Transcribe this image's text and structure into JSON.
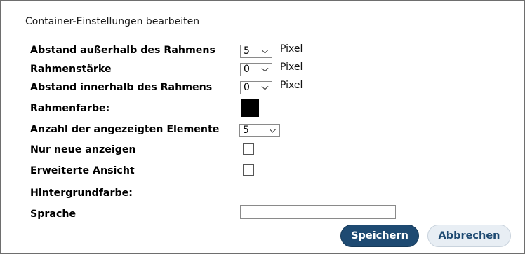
{
  "dialog": {
    "title": "Container-Einstellungen bearbeiten"
  },
  "fields": {
    "margin_outside": {
      "label": "Abstand außerhalb des Rahmens",
      "value": "5",
      "unit": "Pixel"
    },
    "border_width": {
      "label": "Rahmenstärke",
      "value": "0",
      "unit": "Pixel"
    },
    "padding_inside": {
      "label": "Abstand innerhalb des Rahmens",
      "value": "0",
      "unit": "Pixel"
    },
    "border_color": {
      "label": "Rahmenfarbe:",
      "value": "#000000"
    },
    "item_count": {
      "label": "Anzahl der angezeigten Elemente",
      "value": "5"
    },
    "only_new": {
      "label": "Nur neue anzeigen",
      "checked": false
    },
    "extended_view": {
      "label": "Erweiterte Ansicht",
      "checked": false
    },
    "background_color": {
      "label": "Hintergrundfarbe:"
    },
    "language": {
      "label": "Sprache",
      "value": ""
    }
  },
  "actions": {
    "save_label": "Speichern",
    "cancel_label": "Abbrechen"
  },
  "colors": {
    "primary": "#1e4a72",
    "secondary_bg": "#e8eef4"
  }
}
